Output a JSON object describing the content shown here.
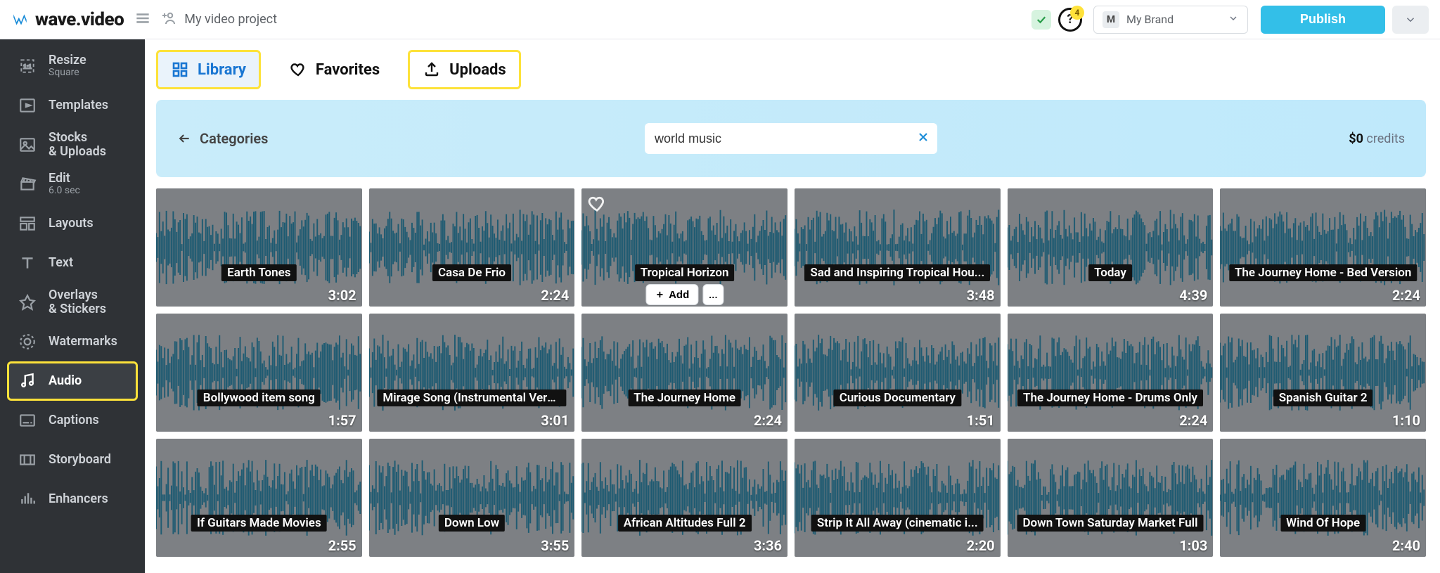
{
  "header": {
    "app_name": "wave.video",
    "project_name": "My video project",
    "help_badge": "4",
    "brand_label": "My Brand",
    "brand_avatar_letter": "M",
    "publish_label": "Publish"
  },
  "sidebar": {
    "items": [
      {
        "label": "Resize",
        "sub": "Square",
        "icon": "ratio-11-icon"
      },
      {
        "label": "Templates",
        "sub": "",
        "icon": "templates-icon"
      },
      {
        "label": "Stocks\n& Uploads",
        "sub": "",
        "icon": "image-icon"
      },
      {
        "label": "Edit",
        "sub": "6.0 sec",
        "icon": "clapper-icon"
      },
      {
        "label": "Layouts",
        "sub": "",
        "icon": "layouts-icon"
      },
      {
        "label": "Text",
        "sub": "",
        "icon": "text-icon"
      },
      {
        "label": "Overlays\n& Stickers",
        "sub": "",
        "icon": "star-icon"
      },
      {
        "label": "Watermarks",
        "sub": "",
        "icon": "watermark-icon"
      },
      {
        "label": "Audio",
        "sub": "",
        "icon": "audio-icon"
      },
      {
        "label": "Captions",
        "sub": "",
        "icon": "captions-icon"
      },
      {
        "label": "Storyboard",
        "sub": "",
        "icon": "storyboard-icon"
      },
      {
        "label": "Enhancers",
        "sub": "",
        "icon": "enhancers-icon"
      }
    ],
    "active_index": 8
  },
  "tabs": {
    "library": "Library",
    "favorites": "Favorites",
    "uploads": "Uploads",
    "active": "library",
    "highlighted": [
      "library",
      "uploads"
    ]
  },
  "category_bar": {
    "back_label": "Categories",
    "search_value": "world music",
    "credits_amount": "$0",
    "credits_label": "credits"
  },
  "tracks": [
    {
      "title": "Earth Tones",
      "duration": "3:02"
    },
    {
      "title": "Casa De Frio",
      "duration": "2:24"
    },
    {
      "title": "Tropical Horizon",
      "duration": "",
      "show_heart": true,
      "show_add": true,
      "add_label": "Add"
    },
    {
      "title": "Sad and Inspiring Tropical Hou...",
      "duration": "3:48"
    },
    {
      "title": "Today",
      "duration": "4:39"
    },
    {
      "title": "The Journey Home - Bed Version",
      "duration": "2:24"
    },
    {
      "title": "Bollywood item song",
      "duration": "1:57"
    },
    {
      "title": "Mirage Song (Instrumental Vers...",
      "duration": "3:01"
    },
    {
      "title": "The Journey Home",
      "duration": "2:24"
    },
    {
      "title": "Curious Documentary",
      "duration": "1:51"
    },
    {
      "title": "The Journey Home - Drums Only",
      "duration": "2:24"
    },
    {
      "title": "Spanish Guitar 2",
      "duration": "1:10"
    },
    {
      "title": "If Guitars Made Movies",
      "duration": "2:55"
    },
    {
      "title": "Down Low",
      "duration": "3:55"
    },
    {
      "title": "African Altitudes Full 2",
      "duration": "3:36"
    },
    {
      "title": "Strip It All Away (cinematic i...",
      "duration": "2:20"
    },
    {
      "title": "Down Town Saturday Market Full",
      "duration": "1:03"
    },
    {
      "title": "Wind Of Hope",
      "duration": "2:40"
    }
  ],
  "colors": {
    "accent": "#33bfe8",
    "highlight": "#fde23a",
    "wave": "#1f5b72"
  }
}
